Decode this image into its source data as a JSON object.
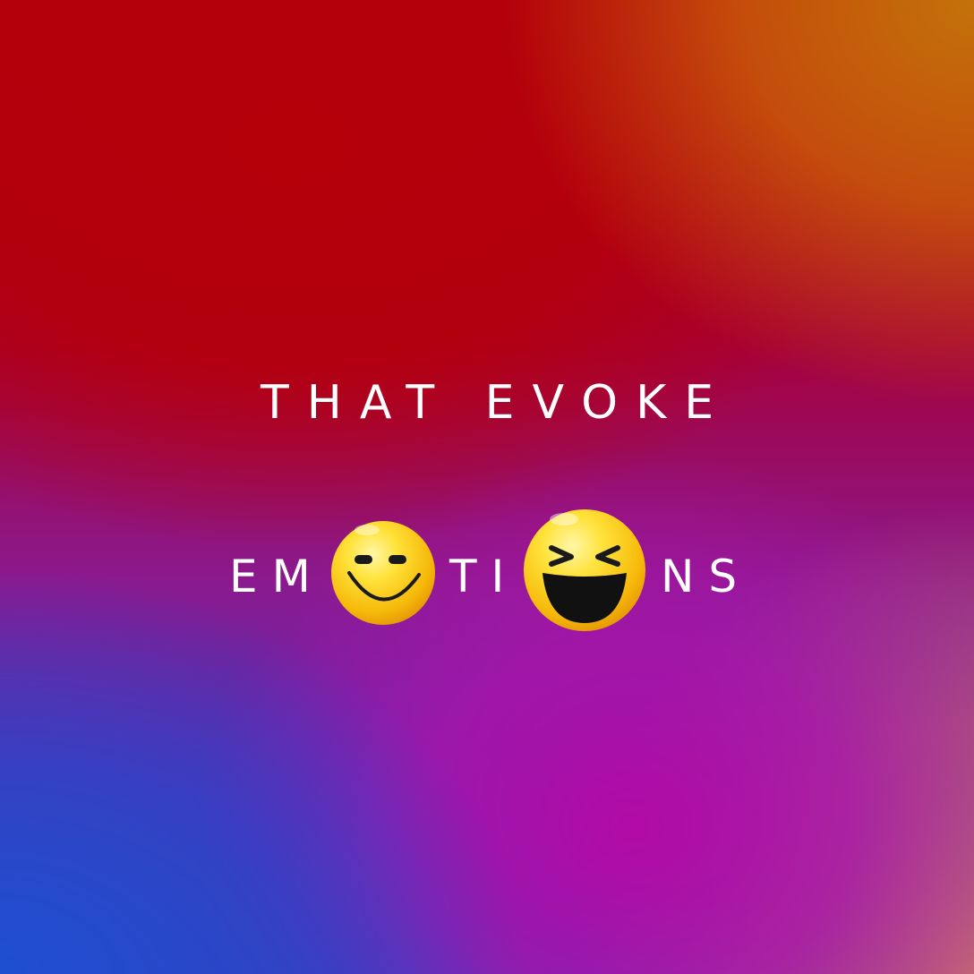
{
  "headline": "THAT EVOKE",
  "emotions_word": {
    "part1": "EM",
    "part2": "TI",
    "part3": "NS"
  },
  "icons": [
    "smiling-face-icon",
    "laughing-squinting-face-icon"
  ],
  "colors": {
    "text": "#ffffff",
    "emoji_yellow": "#ffd21a",
    "emoji_features": "#111111",
    "bg_red": "#b5000a",
    "bg_orange": "#c3720a",
    "bg_magenta": "#b20aa6",
    "bg_blue": "#1d4fd0",
    "bg_salmon": "#c9776a"
  }
}
